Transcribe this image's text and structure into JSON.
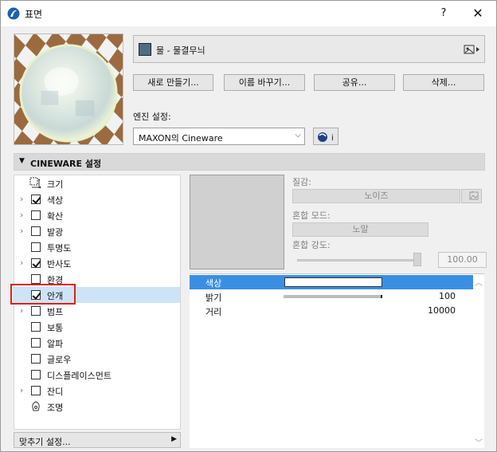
{
  "window": {
    "title": "표면",
    "help": "?",
    "close": "✕"
  },
  "material": {
    "name": "물 - 물결무늬",
    "swatch_color": "#4d6e82"
  },
  "buttons": {
    "new": "새로 만들기...",
    "rename": "이름 바꾸기...",
    "share": "공유...",
    "delete": "삭제..."
  },
  "engine": {
    "label": "엔진 설정:",
    "value": "MAXON의 Cineware",
    "info": "i"
  },
  "section": {
    "title": "CINEWARE 설정"
  },
  "tree": {
    "items": [
      {
        "label": "크기",
        "expander": "",
        "control": "size-icon",
        "checked": false
      },
      {
        "label": "색상",
        "expander": "›",
        "control": "checkbox",
        "checked": true
      },
      {
        "label": "확산",
        "expander": "›",
        "control": "checkbox",
        "checked": false
      },
      {
        "label": "발광",
        "expander": "›",
        "control": "checkbox",
        "checked": false
      },
      {
        "label": "투명도",
        "expander": "",
        "control": "checkbox",
        "checked": false
      },
      {
        "label": "반사도",
        "expander": "›",
        "control": "checkbox",
        "checked": true
      },
      {
        "label": "환경",
        "expander": "",
        "control": "checkbox",
        "checked": false
      },
      {
        "label": "안개",
        "expander": "",
        "control": "checkbox",
        "checked": true,
        "selected": true
      },
      {
        "label": "범프",
        "expander": "›",
        "control": "checkbox",
        "checked": false
      },
      {
        "label": "보통",
        "expander": "",
        "control": "checkbox",
        "checked": false
      },
      {
        "label": "알파",
        "expander": "",
        "control": "checkbox",
        "checked": false
      },
      {
        "label": "글로우",
        "expander": "",
        "control": "checkbox",
        "checked": false
      },
      {
        "label": "디스플레이스먼트",
        "expander": "",
        "control": "checkbox",
        "checked": false
      },
      {
        "label": "잔디",
        "expander": "›",
        "control": "checkbox",
        "checked": false
      },
      {
        "label": "조명",
        "expander": "",
        "control": "light-icon",
        "checked": false
      }
    ]
  },
  "fitting": {
    "label": "맞추기 설정..."
  },
  "texture": {
    "label": "질감:",
    "value": "노이즈",
    "blend_mode_label": "혼합 모드:",
    "blend_mode_value": "노말",
    "blend_strength_label": "혼합 강도:",
    "blend_strength_value": "100.00",
    "blend_strength_level": 1.0
  },
  "properties": [
    {
      "name": "색상",
      "kind": "color",
      "value": "",
      "selected": true
    },
    {
      "name": "밝기",
      "kind": "bar",
      "value": "100",
      "selected": false
    },
    {
      "name": "거리",
      "kind": "text",
      "value": "10000",
      "selected": false
    }
  ],
  "colors": {
    "selection": "#3b8fe3",
    "tree_selection": "#cde4f7",
    "highlight_frame": "#e0201c"
  }
}
